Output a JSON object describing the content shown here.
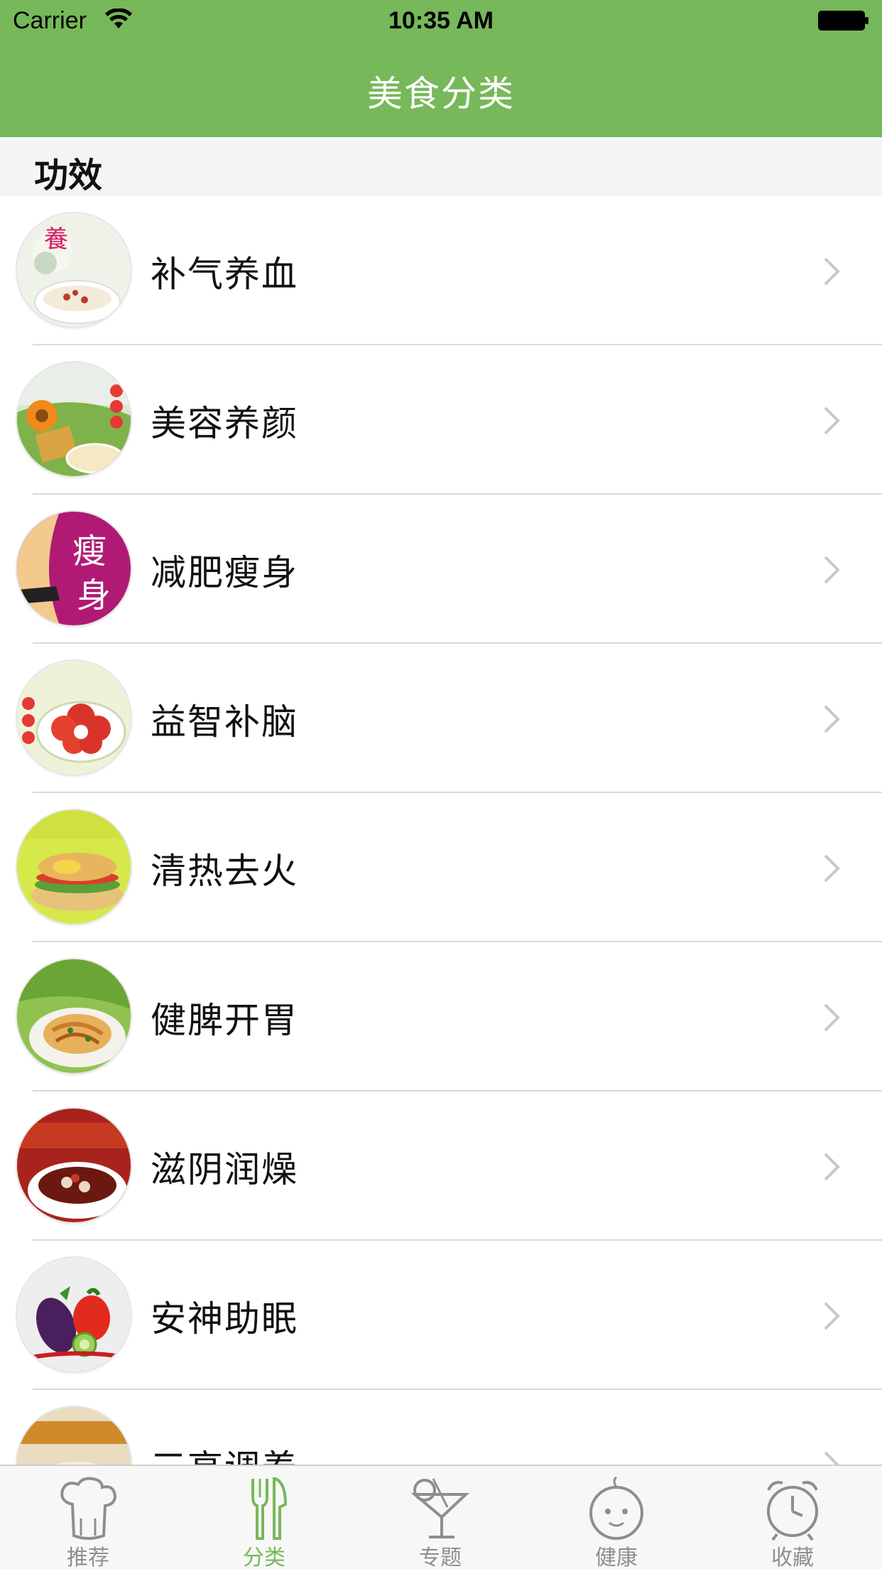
{
  "status_bar": {
    "carrier": "Carrier",
    "time": "10:35 AM"
  },
  "nav": {
    "title": "美食分类"
  },
  "section": {
    "title": "功效"
  },
  "colors": {
    "accent": "#77b85a",
    "tab_inactive": "#8e8e8e",
    "section_bg": "#f5f5f5"
  },
  "categories": [
    {
      "label": "补气养血",
      "icon": "tonic-soup-thumbnail"
    },
    {
      "label": "美容养颜",
      "icon": "beauty-food-thumbnail"
    },
    {
      "label": "减肥瘦身",
      "icon": "slimming-thumbnail"
    },
    {
      "label": "益智补脑",
      "icon": "brain-food-thumbnail"
    },
    {
      "label": "清热去火",
      "icon": "cooling-food-thumbnail"
    },
    {
      "label": "健脾开胃",
      "icon": "appetite-food-thumbnail"
    },
    {
      "label": "滋阴润燥",
      "icon": "nourishing-soup-thumbnail"
    },
    {
      "label": "安神助眠",
      "icon": "vegetables-thumbnail"
    },
    {
      "label": "三高调养",
      "icon": "three-highs-thumbnail"
    }
  ],
  "tabs": [
    {
      "label": "推荐",
      "icon": "chef-hat-icon",
      "active": false
    },
    {
      "label": "分类",
      "icon": "fork-knife-icon",
      "active": true
    },
    {
      "label": "专题",
      "icon": "cocktail-icon",
      "active": false
    },
    {
      "label": "健康",
      "icon": "baby-face-icon",
      "active": false
    },
    {
      "label": "收藏",
      "icon": "alarm-clock-icon",
      "active": false
    }
  ]
}
